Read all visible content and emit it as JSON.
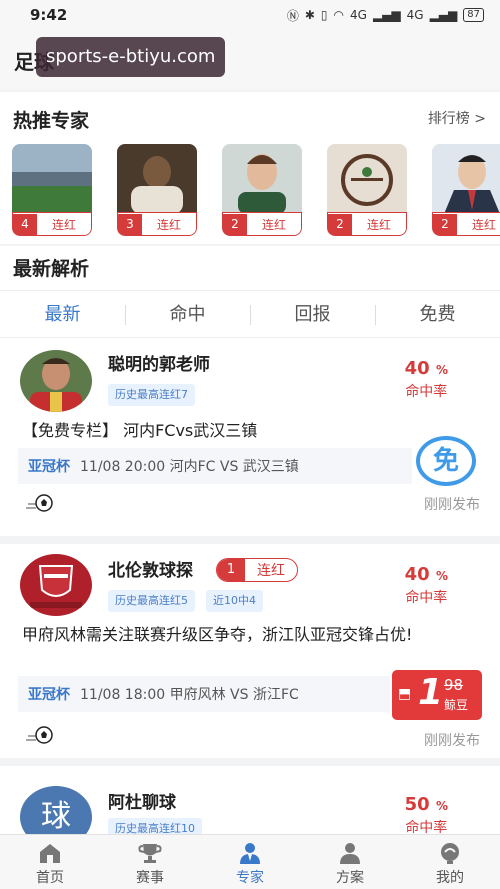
{
  "status": {
    "time": "9:42",
    "signal1": "4G",
    "signal2": "4G",
    "battery": "87"
  },
  "header": {
    "title": "足球",
    "watermark": "sports-e-btiyu.com"
  },
  "hot": {
    "title": "热推专家",
    "rank_link": "排行榜 >",
    "experts": [
      {
        "streak": "4",
        "label": "连红"
      },
      {
        "streak": "3",
        "label": "连红"
      },
      {
        "streak": "2",
        "label": "连红"
      },
      {
        "streak": "2",
        "label": "连红"
      },
      {
        "streak": "2",
        "label": "连红"
      }
    ]
  },
  "latest": {
    "title": "最新解析",
    "tabs": [
      "最新",
      "命中",
      "回报",
      "免费"
    ],
    "active_tab": "最新"
  },
  "cards": [
    {
      "name": "聪明的郭老师",
      "tags": [
        "历史最高连红7"
      ],
      "rate_value": "40",
      "rate_unit": "%",
      "rate_label": "命中率",
      "title": "【免费专栏】 河内FCvs武汉三镇",
      "league": "亚冠杯",
      "match": "11/08 20:00  河内FC VS 武汉三镇",
      "badge": "免",
      "time": "刚刚发布"
    },
    {
      "name": "北伦敦球探",
      "streak": "1",
      "streak_label": "连红",
      "tags": [
        "历史最高连红5",
        "近10中4"
      ],
      "rate_value": "40",
      "rate_unit": "%",
      "rate_label": "命中率",
      "title": "甲府风林需关注联赛升级区争夺，浙江队亚冠交锋占优!",
      "league": "亚冠杯",
      "match": "11/08 18:00  甲府风林 VS 浙江FC",
      "price": "1",
      "price_old": "98",
      "price_unit": "鲸豆",
      "time": "刚刚发布"
    },
    {
      "name": "阿杜聊球",
      "avatar_char": "球",
      "tags": [
        "历史最高连红10"
      ],
      "rate_value": "50",
      "rate_unit": "%",
      "rate_label": "命中率"
    }
  ],
  "nav": [
    {
      "label": "首页",
      "icon": "home-icon"
    },
    {
      "label": "赛事",
      "icon": "trophy-icon"
    },
    {
      "label": "专家",
      "icon": "expert-icon"
    },
    {
      "label": "方案",
      "icon": "plan-icon"
    },
    {
      "label": "我的",
      "icon": "profile-icon"
    }
  ],
  "colors": {
    "accent": "#3a78c9",
    "red": "#d63b3b"
  }
}
